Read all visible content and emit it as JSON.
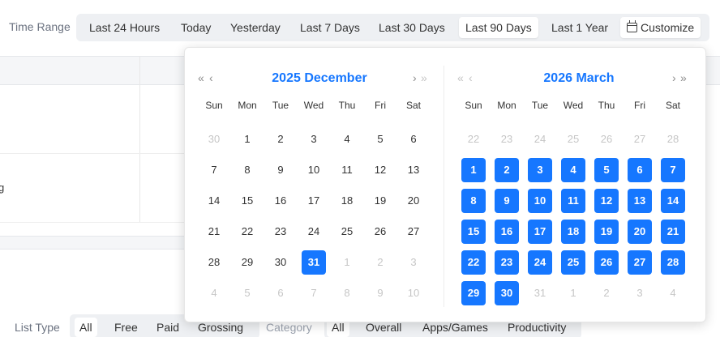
{
  "time_range": {
    "label": "Time Range",
    "options": [
      "Last 24 Hours",
      "Today",
      "Yesterday",
      "Last 7 Days",
      "Last 30 Days",
      "Last 90 Days",
      "Last 1 Year"
    ],
    "active": "Last 90 Days",
    "customize_label": "Customize"
  },
  "background": {
    "clipped_text": "g"
  },
  "list_type": {
    "label": "List Type",
    "options": [
      "All",
      "Free",
      "Paid",
      "Grossing"
    ],
    "active": "All"
  },
  "category": {
    "label": "Category",
    "options": [
      "All",
      "Overall",
      "Apps/Games",
      "Productivity"
    ],
    "active": "All"
  },
  "calendar": {
    "weekdays": [
      "Sun",
      "Mon",
      "Tue",
      "Wed",
      "Thu",
      "Fri",
      "Sat"
    ],
    "left": {
      "title": "2025 December",
      "weeks": [
        [
          {
            "d": "30",
            "m": true
          },
          {
            "d": "1"
          },
          {
            "d": "2"
          },
          {
            "d": "3"
          },
          {
            "d": "4"
          },
          {
            "d": "5"
          },
          {
            "d": "6"
          }
        ],
        [
          {
            "d": "7"
          },
          {
            "d": "8"
          },
          {
            "d": "9"
          },
          {
            "d": "10"
          },
          {
            "d": "11"
          },
          {
            "d": "12"
          },
          {
            "d": "13"
          }
        ],
        [
          {
            "d": "14"
          },
          {
            "d": "15"
          },
          {
            "d": "16"
          },
          {
            "d": "17"
          },
          {
            "d": "18"
          },
          {
            "d": "19"
          },
          {
            "d": "20"
          }
        ],
        [
          {
            "d": "21"
          },
          {
            "d": "22"
          },
          {
            "d": "23"
          },
          {
            "d": "24"
          },
          {
            "d": "25"
          },
          {
            "d": "26"
          },
          {
            "d": "27"
          }
        ],
        [
          {
            "d": "28"
          },
          {
            "d": "29"
          },
          {
            "d": "30"
          },
          {
            "d": "31",
            "s": true
          },
          {
            "d": "1",
            "m": true
          },
          {
            "d": "2",
            "m": true
          },
          {
            "d": "3",
            "m": true
          }
        ],
        [
          {
            "d": "4",
            "m": true
          },
          {
            "d": "5",
            "m": true
          },
          {
            "d": "6",
            "m": true
          },
          {
            "d": "7",
            "m": true
          },
          {
            "d": "8",
            "m": true
          },
          {
            "d": "9",
            "m": true
          },
          {
            "d": "10",
            "m": true
          }
        ]
      ]
    },
    "right": {
      "title": "2026 March",
      "weeks": [
        [
          {
            "d": "22",
            "m": true
          },
          {
            "d": "23",
            "m": true
          },
          {
            "d": "24",
            "m": true
          },
          {
            "d": "25",
            "m": true
          },
          {
            "d": "26",
            "m": true
          },
          {
            "d": "27",
            "m": true
          },
          {
            "d": "28",
            "m": true
          }
        ],
        [
          {
            "d": "1",
            "s": true
          },
          {
            "d": "2",
            "s": true
          },
          {
            "d": "3",
            "s": true
          },
          {
            "d": "4",
            "s": true
          },
          {
            "d": "5",
            "s": true
          },
          {
            "d": "6",
            "s": true
          },
          {
            "d": "7",
            "s": true
          }
        ],
        [
          {
            "d": "8",
            "s": true
          },
          {
            "d": "9",
            "s": true
          },
          {
            "d": "10",
            "s": true
          },
          {
            "d": "11",
            "s": true
          },
          {
            "d": "12",
            "s": true
          },
          {
            "d": "13",
            "s": true
          },
          {
            "d": "14",
            "s": true
          }
        ],
        [
          {
            "d": "15",
            "s": true
          },
          {
            "d": "16",
            "s": true
          },
          {
            "d": "17",
            "s": true
          },
          {
            "d": "18",
            "s": true
          },
          {
            "d": "19",
            "s": true
          },
          {
            "d": "20",
            "s": true
          },
          {
            "d": "21",
            "s": true
          }
        ],
        [
          {
            "d": "22",
            "s": true
          },
          {
            "d": "23",
            "s": true
          },
          {
            "d": "24",
            "s": true
          },
          {
            "d": "25",
            "s": true
          },
          {
            "d": "26",
            "s": true
          },
          {
            "d": "27",
            "s": true
          },
          {
            "d": "28",
            "s": true
          }
        ],
        [
          {
            "d": "29",
            "s": true
          },
          {
            "d": "30",
            "s": true
          },
          {
            "d": "31",
            "m": true
          },
          {
            "d": "1",
            "m": true
          },
          {
            "d": "2",
            "m": true
          },
          {
            "d": "3",
            "m": true
          },
          {
            "d": "4",
            "m": true
          }
        ]
      ]
    },
    "nav_icons": {
      "prev_year": "double-chevron-left-icon",
      "prev_month": "chevron-left-icon",
      "next_month": "chevron-right-icon",
      "next_year": "double-chevron-right-icon"
    }
  },
  "colors": {
    "accent": "#1677ff",
    "muted_day": "#c6c6c6",
    "group_bg": "#eef0f3"
  }
}
